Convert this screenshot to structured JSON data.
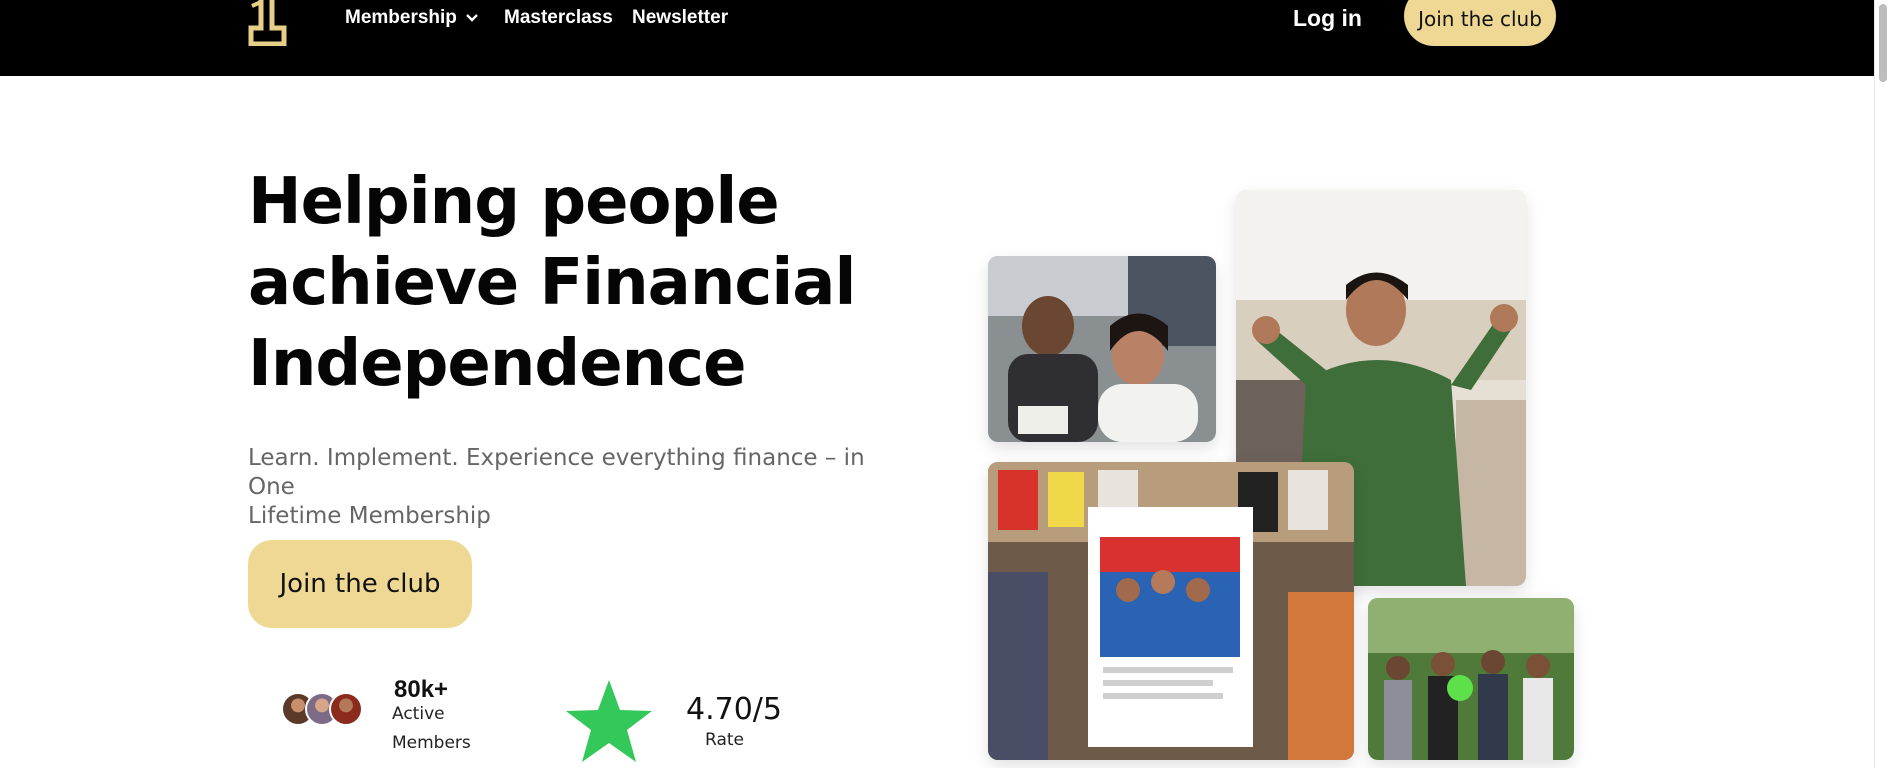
{
  "header": {
    "logo_icon": "brand-one-icon",
    "nav": [
      {
        "label": "Membership",
        "has_dropdown": true
      },
      {
        "label": "Masterclass"
      },
      {
        "label": "Newsletter"
      }
    ],
    "login_label": "Log in",
    "cta_label": "Join the club"
  },
  "hero": {
    "title_lines": [
      "Helping people",
      "achieve Financial",
      "Independence"
    ],
    "subtitle_lines": [
      "Learn. Implement. Experience everything finance – in One",
      "Lifetime Membership"
    ],
    "cta_label": "Join the club"
  },
  "stats": {
    "members": {
      "value": "80k+",
      "label_line1": "Active",
      "label_line2": "Members"
    },
    "rating": {
      "value": "4.70/5",
      "label": "Rate",
      "icon": "star-icon"
    }
  },
  "colors": {
    "header_bg": "#000000",
    "accent": "#eed894",
    "star": "#34c759",
    "subtitle": "#666666"
  }
}
